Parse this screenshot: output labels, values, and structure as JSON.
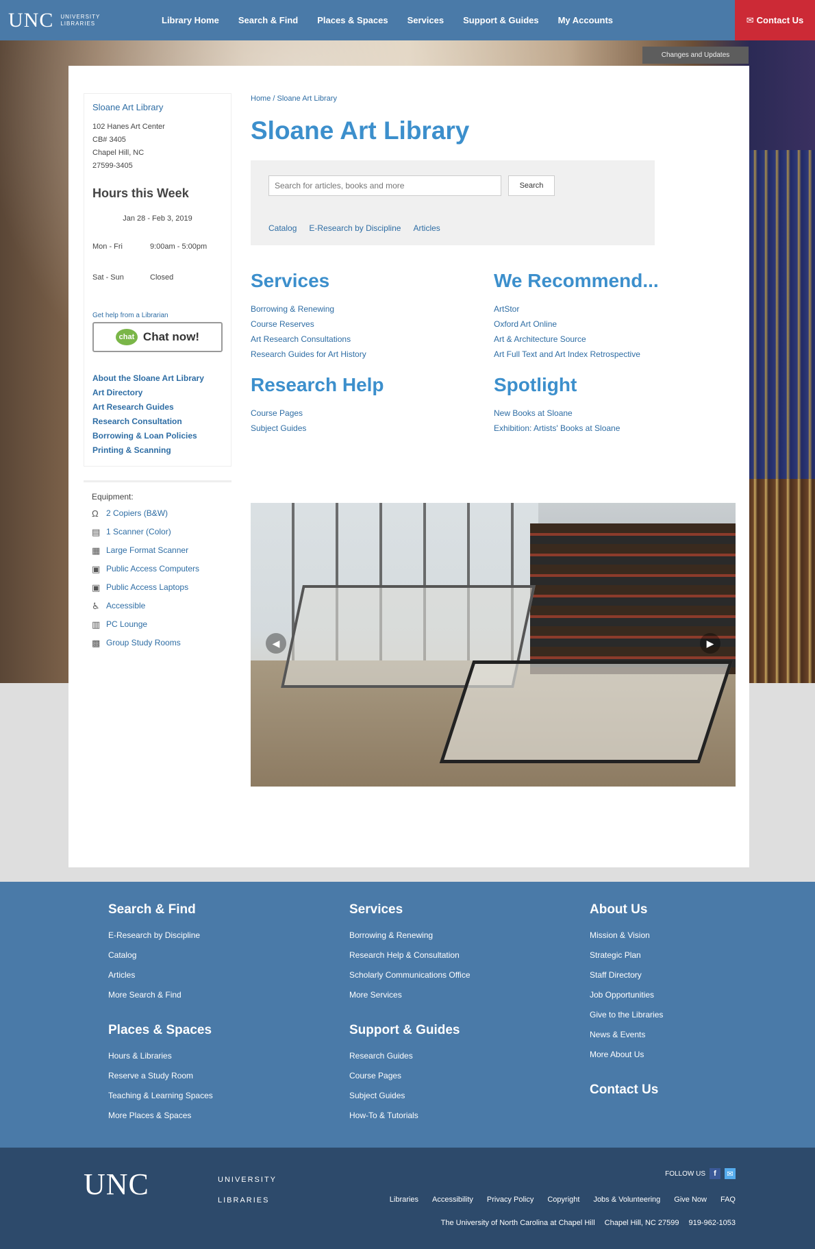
{
  "nav": {
    "logo": "UNC",
    "logo_sub_1": "UNIVERSITY",
    "logo_sub_2": "LIBRARIES",
    "items": [
      "Library Home",
      "Search & Find",
      "Places & Spaces",
      "Services",
      "Support & Guides",
      "My Accounts"
    ],
    "contact": "Contact Us"
  },
  "updated": "Changes and Updates",
  "sidebar": {
    "title": "Sloane Art Library",
    "address": [
      "102 Hanes Art Center",
      "CB# 3405",
      "Chapel Hill, NC",
      "27599-3405"
    ],
    "hours_title": "Hours this Week",
    "week_range": "Jan 28 - Feb 3, 2019",
    "hours": [
      {
        "day": "Mon - Fri",
        "time": "9:00am - 5:00pm"
      },
      {
        "day": "Sat - Sun",
        "time": "Closed"
      }
    ],
    "chat_small": "Get help from a Librarian",
    "chat_label": "Chat now!",
    "links": [
      "About the Sloane Art Library",
      "Art Directory",
      "Art Research Guides",
      "Research Consultation",
      "Borrowing & Loan Policies",
      "Printing & Scanning"
    ],
    "equip_title": "Equipment:",
    "equipment": [
      {
        "icon": "Ω",
        "label": "2 Copiers (B&W)"
      },
      {
        "icon": "▤",
        "label": "1 Scanner (Color)"
      },
      {
        "icon": "▦",
        "label": "Large Format Scanner"
      },
      {
        "icon": "▣",
        "label": "Public Access Computers"
      },
      {
        "icon": "▣",
        "label": "Public Access Laptops"
      },
      {
        "icon": "♿",
        "label": "Accessible"
      },
      {
        "icon": "▥",
        "label": "PC Lounge"
      },
      {
        "icon": "▩",
        "label": "Group Study Rooms"
      }
    ]
  },
  "content": {
    "breadcrumb": "Home / Sloane Art Library",
    "title": "Sloane Art Library",
    "search_placeholder": "Search for articles, books and more",
    "search_button": "Search",
    "search_options": [
      "Catalog",
      "E-Research by Discipline",
      "Articles"
    ],
    "services_title": "Services",
    "services": [
      "Borrowing & Renewing",
      "Course Reserves",
      "Art Research Consultations",
      "Research Guides for Art History"
    ],
    "recommend_title": "We Recommend...",
    "recommend": [
      "ArtStor",
      "Oxford Art Online",
      "Art & Architecture Source",
      "Art Full Text and Art Index Retrospective"
    ],
    "research_title": "Research Help",
    "research": [
      "Course Pages",
      "Subject Guides"
    ],
    "spotlight_title": "Spotlight",
    "spotlight": [
      "New Books at Sloane",
      "Exhibition: Artists' Books at Sloane"
    ]
  },
  "footer": {
    "cols": [
      {
        "groups": [
          {
            "title": "Search & Find",
            "links": [
              "E-Research by Discipline",
              "Catalog",
              "Articles",
              "More Search & Find"
            ]
          },
          {
            "title": "Places & Spaces",
            "links": [
              "Hours & Libraries",
              "Reserve a Study Room",
              "Teaching & Learning Spaces",
              "More Places & Spaces"
            ]
          }
        ]
      },
      {
        "groups": [
          {
            "title": "Services",
            "links": [
              "Borrowing & Renewing",
              "Research Help & Consultation",
              "Scholarly Communications Office",
              "More Services"
            ]
          },
          {
            "title": "Support & Guides",
            "links": [
              "Research Guides",
              "Course Pages",
              "Subject Guides",
              "How-To & Tutorials"
            ]
          }
        ]
      },
      {
        "groups": [
          {
            "title": "About Us",
            "links": [
              "Mission & Vision",
              "Strategic Plan",
              "Staff Directory",
              "Job Opportunities",
              "Give to the Libraries",
              "News & Events",
              "More About Us"
            ]
          },
          {
            "title": "Contact Us",
            "links": []
          }
        ]
      }
    ]
  },
  "footer2": {
    "logo": "UNC",
    "sub_1": "UNIVERSITY",
    "sub_2": "LIBRARIES",
    "follow": "FOLLOW US",
    "links": [
      "Libraries",
      "Accessibility",
      "Privacy Policy",
      "Copyright",
      "Jobs & Volunteering",
      "Give Now",
      "FAQ"
    ],
    "copyright": [
      "The University of North Carolina at Chapel Hill",
      "Chapel Hill, NC 27599",
      "919-962-1053"
    ]
  }
}
